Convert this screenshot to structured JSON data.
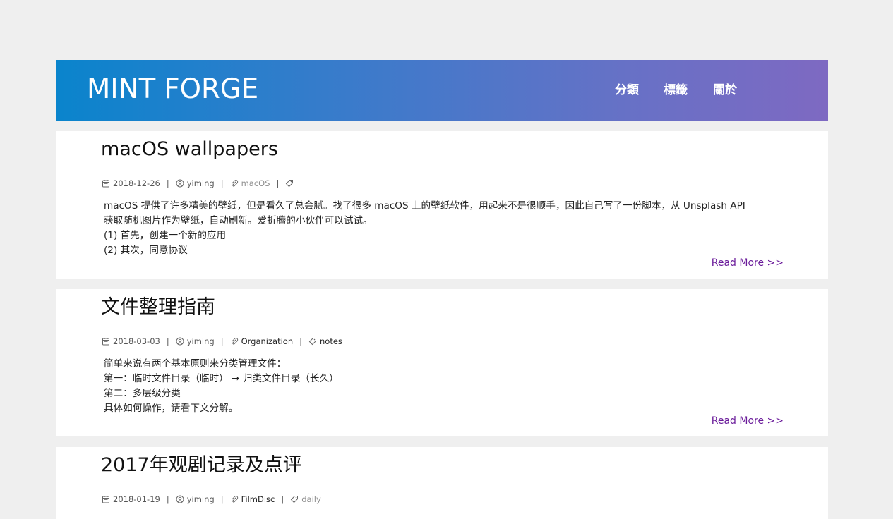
{
  "site": {
    "logo": "MINT FORGE",
    "nav": [
      {
        "label": "分類"
      },
      {
        "label": "標籤"
      },
      {
        "label": "關於"
      }
    ],
    "colors": {
      "header_gradient_start": "#0a84cc",
      "header_gradient_end": "#7e69c2",
      "read_more": "#6a1b9a",
      "page_background": "#efefef"
    }
  },
  "posts": [
    {
      "title": "macOS wallpapers",
      "date": "2018-12-26",
      "author": "yiming",
      "category": "macOS",
      "tag": "",
      "excerpt": [
        "macOS 提供了许多精美的壁纸，但是看久了总会腻。找了很多 macOS 上的壁纸软件，用起来不是很顺手，因此自己写了一份脚本，从 Unsplash API",
        "获取随机图片作为壁纸，自动刷新。爱折腾的小伙伴可以试试。",
        "(1) 首先，创建一个新的应用",
        "(2) 其次，同意协议"
      ],
      "read_more": "Read More >>"
    },
    {
      "title": "文件整理指南",
      "date": "2018-03-03",
      "author": "yiming",
      "category": "Organization",
      "tag": "notes",
      "excerpt": [
        "简单来说有两个基本原则来分类管理文件：",
        "第一：临时文件目录（临时） ➞ 归类文件目录（长久）",
        "第二：多层级分类",
        "具体如何操作，请看下文分解。"
      ],
      "read_more": "Read More >>"
    },
    {
      "title": "2017年观剧记录及点评",
      "date": "2018-01-19",
      "author": "yiming",
      "category": "FilmDisc",
      "tag": "daily"
    }
  ],
  "icons": {
    "date": "calendar-icon",
    "author": "user-icon",
    "category": "paperclip-icon",
    "tag": "tag-icon"
  }
}
